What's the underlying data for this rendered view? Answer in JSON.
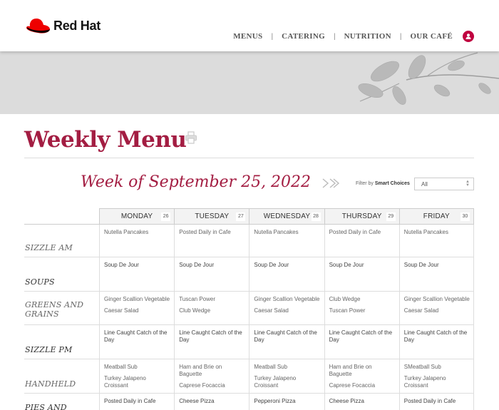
{
  "brand": {
    "name": "Red Hat",
    "color": "#ee0000",
    "accent": "#a31d42"
  },
  "nav": {
    "items": [
      "MENUS",
      "CATERING",
      "NUTRITION",
      "OUR CAFÉ"
    ],
    "user_icon": "user-icon"
  },
  "page": {
    "title": "Weekly Menu",
    "week": "Week of September 25, 2022",
    "filter_prefix": "Filter by ",
    "filter_bold": "Smart Choices",
    "filter_value": "All"
  },
  "days": [
    {
      "name": "MONDAY",
      "num": "26"
    },
    {
      "name": "TUESDAY",
      "num": "27"
    },
    {
      "name": "WEDNESDAY",
      "num": "28"
    },
    {
      "name": "THURSDAY",
      "num": "29"
    },
    {
      "name": "FRIDAY",
      "num": "30"
    }
  ],
  "rows": [
    {
      "category": "SIZZLE AM",
      "cells": [
        [
          "Nutella Pancakes"
        ],
        [
          "Posted Daily in Cafe"
        ],
        [
          "Nutella Pancakes"
        ],
        [
          "Posted Daily in Cafe"
        ],
        [
          "Nutella Pancakes"
        ]
      ]
    },
    {
      "category": "SOUPS",
      "cells": [
        [
          "Soup De Jour"
        ],
        [
          "Soup De Jour"
        ],
        [
          "Soup De Jour"
        ],
        [
          "Soup De Jour"
        ],
        [
          "Soup De Jour"
        ]
      ]
    },
    {
      "category": "GREENS AND GRAINS",
      "cells": [
        [
          "Ginger Scallion Vegetable",
          "Caesar Salad"
        ],
        [
          "Tuscan Power",
          "Club Wedge"
        ],
        [
          "Ginger Scallion Vegetable",
          "Caesar Salad"
        ],
        [
          "Club Wedge",
          "Tuscan Power"
        ],
        [
          "Ginger Scallion Vegetable",
          "Caesar Salad"
        ]
      ]
    },
    {
      "category": "SIZZLE PM",
      "cells": [
        [
          "Line Caught Catch of the Day"
        ],
        [
          "Line Caught Catch of the Day"
        ],
        [
          "Line Caught Catch of the Day"
        ],
        [
          "Line Caught Catch of the Day"
        ],
        [
          "Line Caught Catch of the Day"
        ]
      ]
    },
    {
      "category": "HANDHELD",
      "cells": [
        [
          "Meatball Sub",
          "Turkey Jalapeno Croissant"
        ],
        [
          "Ham and Brie on Baguette",
          "Caprese Focaccia"
        ],
        [
          "Meatball Sub",
          "Turkey Jalapeno Croissant"
        ],
        [
          "Ham and Brie on Baguette",
          "Caprese Focaccia"
        ],
        [
          "SMeatball Sub",
          "Turkey Jalapeno Croissant"
        ]
      ]
    },
    {
      "category": "PIES AND",
      "cells": [
        [
          "Posted Daily in Cafe"
        ],
        [
          "Cheese Pizza"
        ],
        [
          "Pepperoni Pizza"
        ],
        [
          "Cheese Pizza"
        ],
        [
          "Posted Daily in Cafe"
        ]
      ]
    }
  ]
}
